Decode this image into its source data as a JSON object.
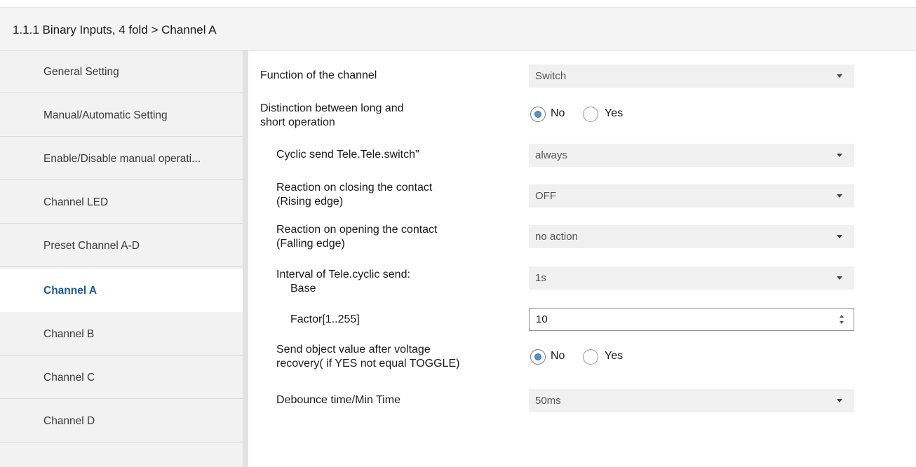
{
  "header": {
    "title": "1.1.1 Binary Inputs, 4 fold > Channel A"
  },
  "sidebar": {
    "items": [
      {
        "label": "General Setting"
      },
      {
        "label": "Manual/Automatic Setting"
      },
      {
        "label": "Enable/Disable manual operati..."
      },
      {
        "label": "Channel LED"
      },
      {
        "label": "Preset Channel A-D"
      },
      {
        "label": "Channel A",
        "active": true
      },
      {
        "label": "Channel B"
      },
      {
        "label": "Channel C"
      },
      {
        "label": "Channel D"
      }
    ]
  },
  "params": {
    "function": {
      "label": "Function of the channel",
      "value": "Switch"
    },
    "distinction": {
      "label_line1": "Distinction between long and",
      "label_line2": "short operation",
      "selected": "No",
      "options": [
        "No",
        "Yes"
      ]
    },
    "cyclic_send": {
      "label": "Cyclic send Tele.Tele.switch\"",
      "value": "always"
    },
    "reaction_closing": {
      "label_line1": "Reaction on closing the contact",
      "label_line2": "(Rising edge)",
      "value": "OFF"
    },
    "reaction_opening": {
      "label_line1": "Reaction on opening the contact",
      "label_line2": "(Falling edge)",
      "value": "no action"
    },
    "interval": {
      "label_line1": "Interval of Tele.cyclic send:",
      "label_line2": "Base",
      "value": "1s"
    },
    "factor": {
      "label": "Factor[1..255]",
      "value": "10"
    },
    "send_after_recovery": {
      "label_line1": "Send object value after voltage",
      "label_line2": "recovery( if YES not equal TOGGLE)",
      "selected": "No",
      "options": [
        "No",
        "Yes"
      ]
    },
    "debounce": {
      "label": "Debounce time/Min Time",
      "value": "50ms"
    }
  },
  "colors": {
    "active_nav": "#1d5a9a",
    "sidebar_bg": "#f2f2f2",
    "radio_fill": "#5a8fc8"
  }
}
